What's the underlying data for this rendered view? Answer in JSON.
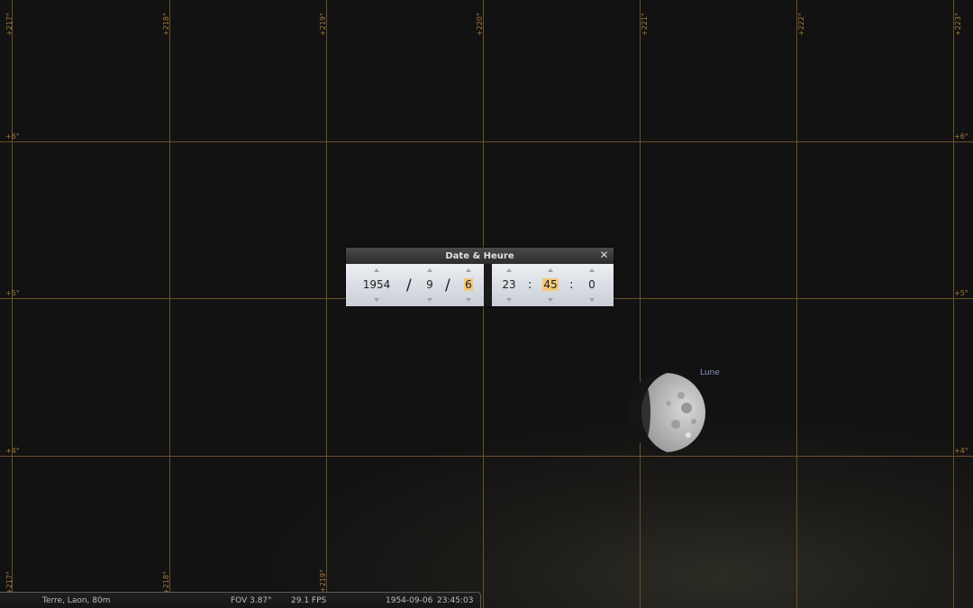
{
  "grid": {
    "ra_labels": [
      "+217°",
      "+218°",
      "+219°",
      "+220°",
      "+221°",
      "+222°",
      "+223°"
    ],
    "dec_labels": [
      "+6°",
      "+5°",
      "+4°"
    ]
  },
  "object": {
    "label": "Lune",
    "label_color": "#8a93c9"
  },
  "dialog": {
    "title": "Date & Heure",
    "close_icon": "close-icon",
    "date": {
      "year": "1954",
      "month": "9",
      "day": "6",
      "separator": "/"
    },
    "time": {
      "hour": "23",
      "minute": "45",
      "second": "0",
      "separator": ":"
    }
  },
  "status_bar": {
    "location": "Terre, Laon, 80m",
    "fov": "FOV 3.87°",
    "fps": "29.1 FPS",
    "date": "1954-09-06",
    "time": "23:45:03"
  },
  "colors": {
    "grid": "#6b5028",
    "grid_label": "#a47a3c",
    "highlight": "#f3c87a"
  }
}
